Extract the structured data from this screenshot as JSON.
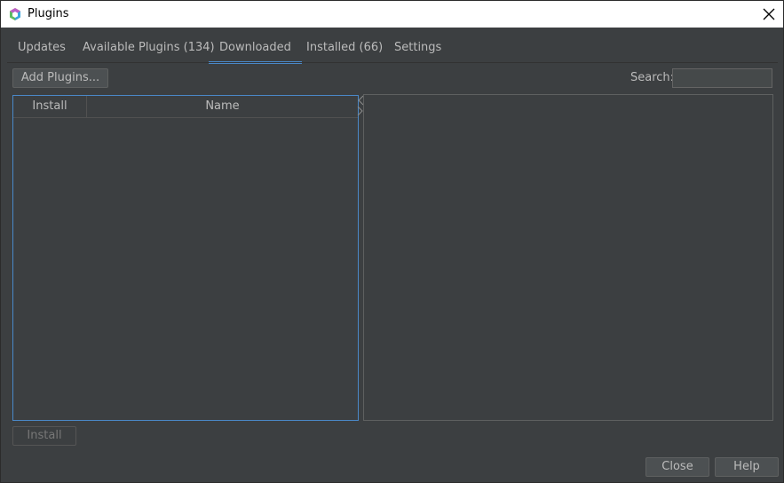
{
  "window": {
    "title": "Plugins",
    "icons": {
      "app": "netbeans-cube-icon",
      "close": "close-icon"
    }
  },
  "tabs": [
    {
      "label": "Updates",
      "active": false
    },
    {
      "label": "Available Plugins (134)",
      "active": false
    },
    {
      "label": "Downloaded",
      "active": true
    },
    {
      "label": "Installed (66)",
      "active": false
    },
    {
      "label": "Settings",
      "active": false
    }
  ],
  "toolbar": {
    "add_plugins_label": "Add Plugins...",
    "search_label": "Search:",
    "search_value": ""
  },
  "table": {
    "columns": [
      "Install",
      "Name"
    ],
    "rows": []
  },
  "footer": {
    "install_label": "Install",
    "close_label": "Close",
    "help_label": "Help"
  },
  "colors": {
    "background": "#3c3f41",
    "accent": "#4a88c7",
    "text": "#bbbbbb"
  }
}
